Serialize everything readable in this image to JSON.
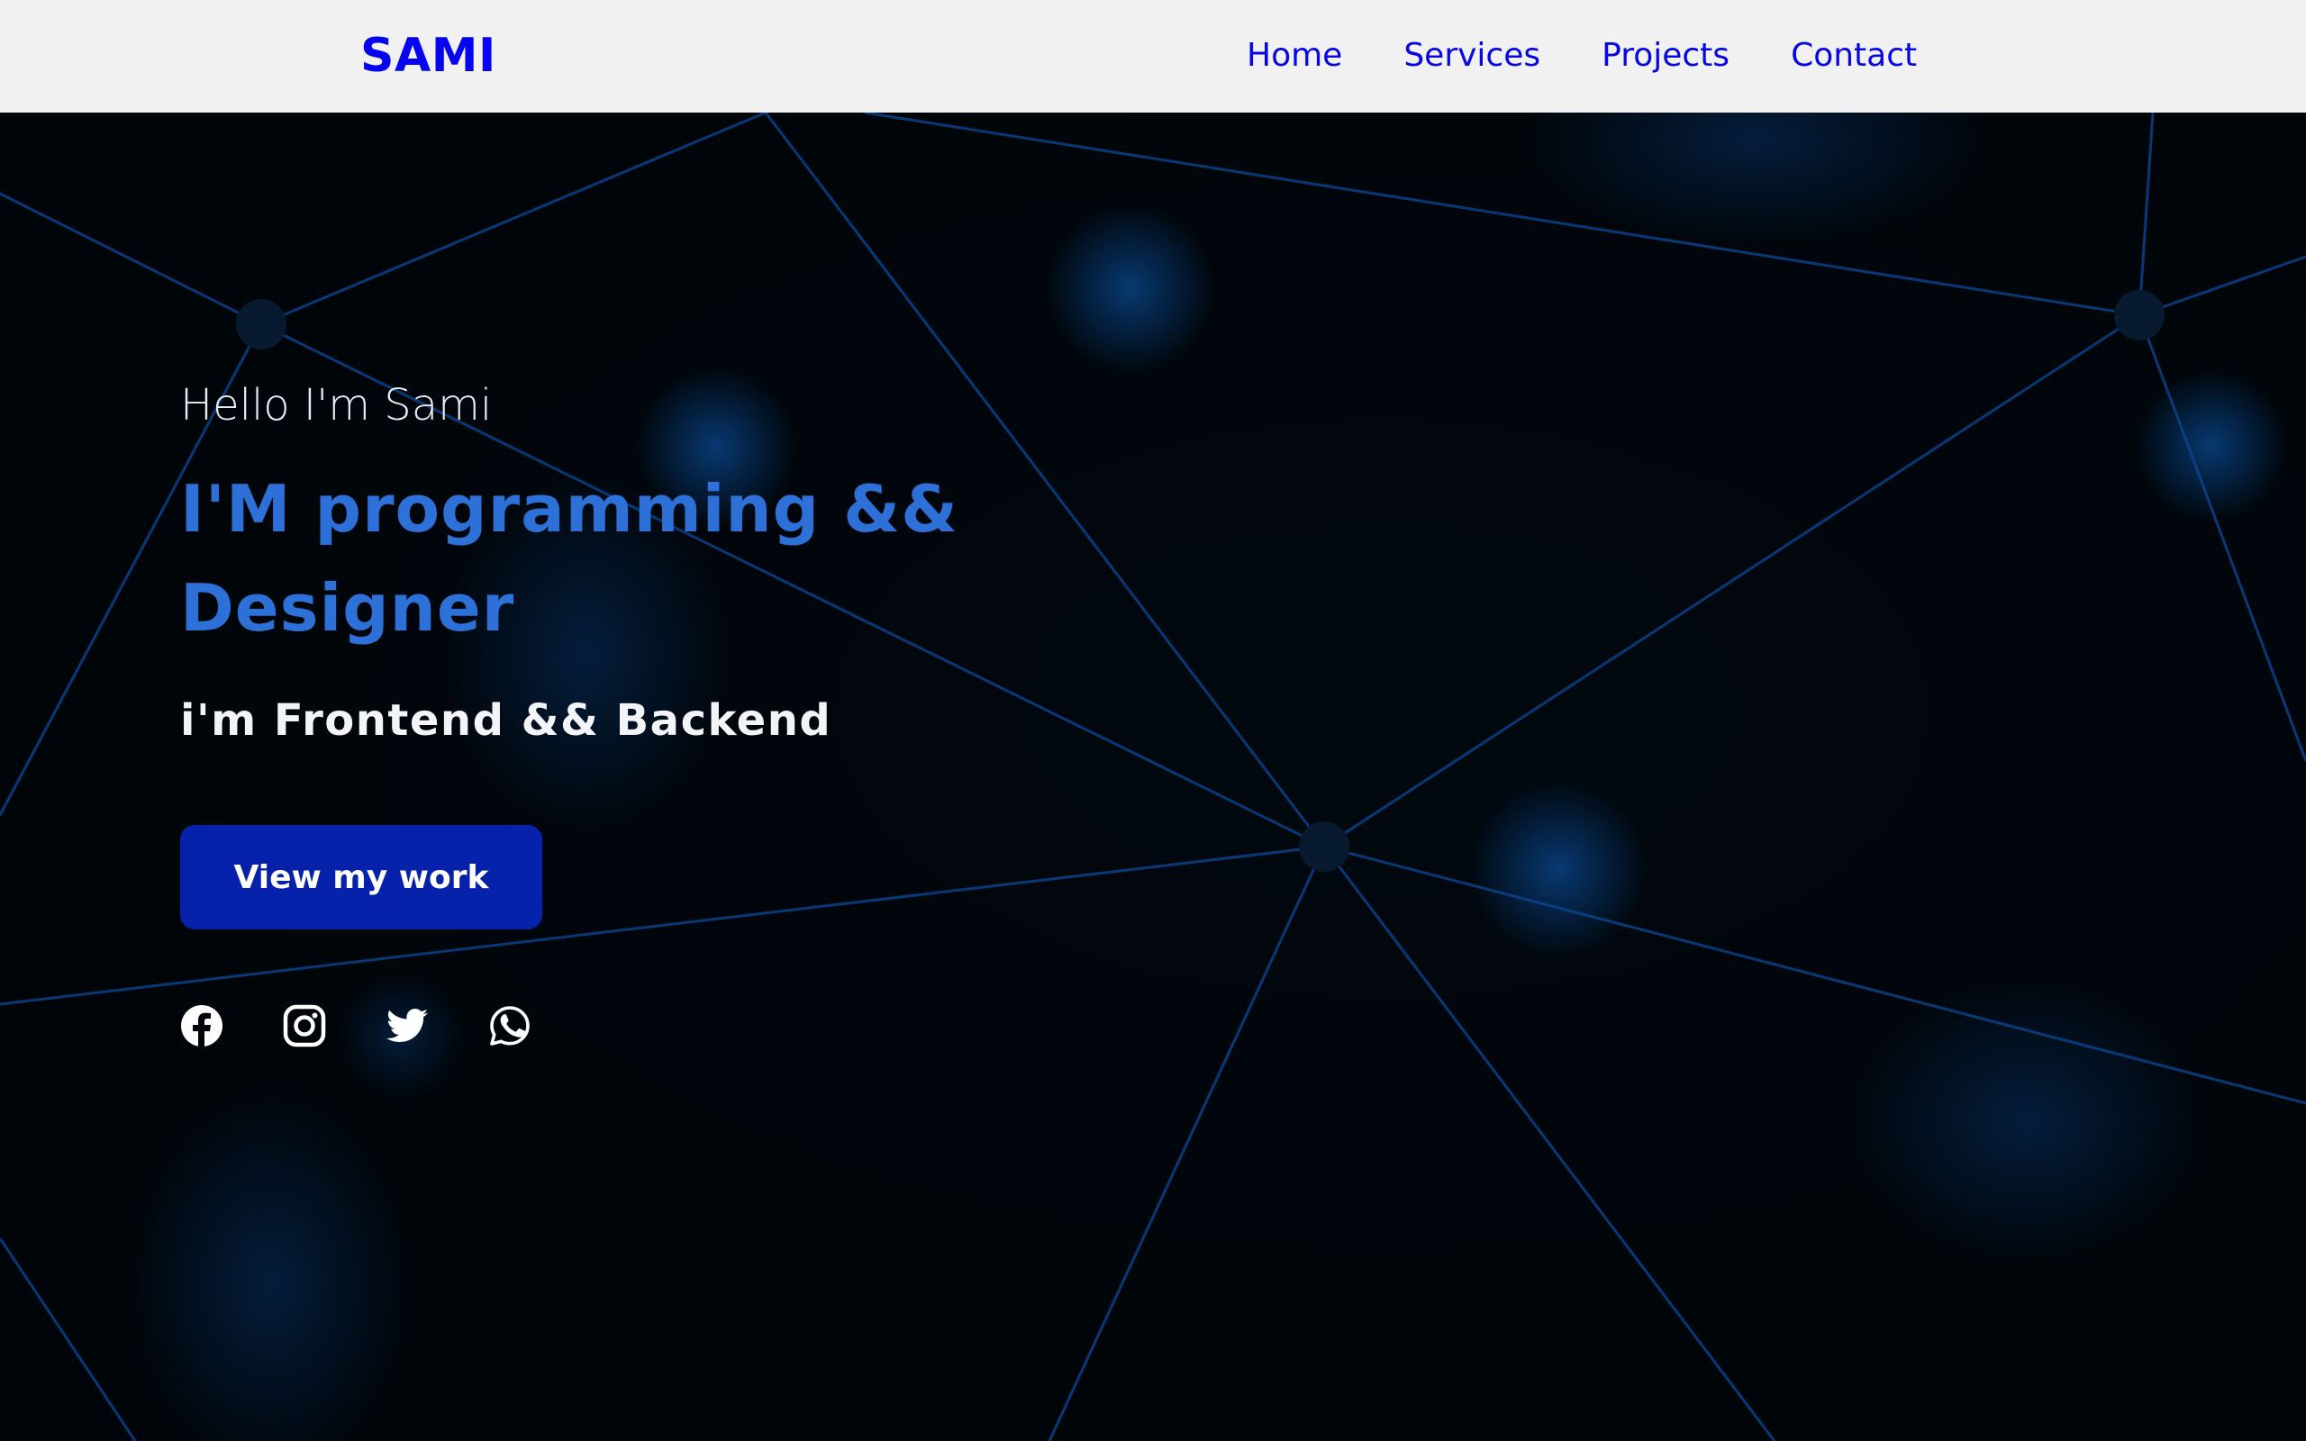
{
  "brand": "SAMI",
  "nav": {
    "links": [
      "Home",
      "Services",
      "Projects",
      "Contact"
    ]
  },
  "hero": {
    "greeting": "Hello I'm Sami",
    "headline": "I'M programming && Designer",
    "subline": "i'm Frontend && Backend",
    "cta_label": "View my work",
    "socials": [
      "facebook-icon",
      "instagram-icon",
      "twitter-icon",
      "whatsapp-icon"
    ]
  },
  "colors": {
    "nav_background": "#f1f1f1",
    "brand": "#0505ef",
    "nav_link": "#0707e6",
    "hero_background": "#000509",
    "headline": "#2d71d8",
    "cta_background": "#0722aa",
    "network_lines": "#0b4a9a"
  }
}
